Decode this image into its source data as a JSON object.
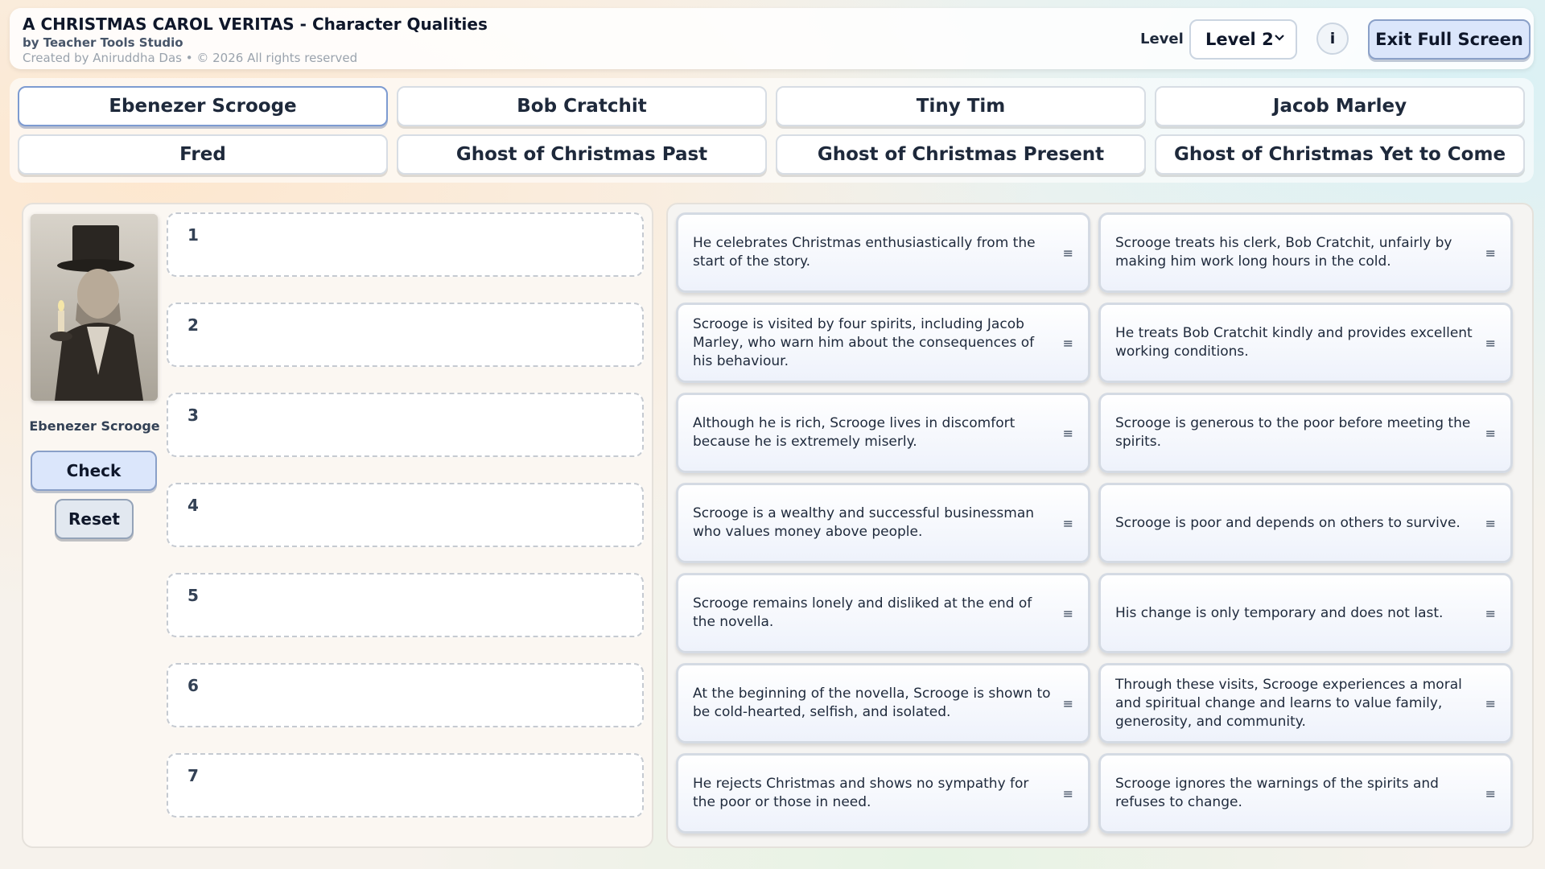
{
  "header": {
    "title": "A CHRISTMAS CAROL VERITAS - Character Qualities",
    "byline": "by Teacher Tools Studio",
    "credit": "Created by Aniruddha Das • © 2026 All rights reserved",
    "level_label": "Level",
    "level_value": "Level 2",
    "info_label": "i",
    "exit_label": "Exit Full Screen"
  },
  "tabs": [
    {
      "label": "Ebenezer Scrooge",
      "active": true
    },
    {
      "label": "Bob Cratchit"
    },
    {
      "label": "Tiny Tim"
    },
    {
      "label": "Jacob Marley"
    },
    {
      "label": "Fred"
    },
    {
      "label": "Ghost of Christmas Past"
    },
    {
      "label": "Ghost of Christmas Present"
    },
    {
      "label": "Ghost of Christmas Yet to Come"
    }
  ],
  "character": {
    "name": "Ebenezer Scrooge",
    "check_label": "Check",
    "reset_label": "Reset"
  },
  "slots": [
    "1",
    "2",
    "3",
    "4",
    "5",
    "6",
    "7"
  ],
  "cards": [
    "He celebrates Christmas enthusiastically from the start of the story.",
    "Scrooge treats his clerk, Bob Cratchit, unfairly by making him work long hours in the cold.",
    "Scrooge is visited by four spirits, including Jacob Marley, who warn him about the consequences of his behaviour.",
    "He treats Bob Cratchit kindly and provides excellent working conditions.",
    "Although he is rich, Scrooge lives in discomfort because he is extremely miserly.",
    "Scrooge is generous to the poor before meeting the spirits.",
    "Scrooge is a wealthy and successful businessman who values money above people.",
    "Scrooge is poor and depends on others to survive.",
    "Scrooge remains lonely and disliked at the end of the novella.",
    "His change is only temporary and does not last.",
    "At the beginning of the novella, Scrooge is shown to be cold-hearted, selfish, and isolated.",
    "Through these visits, Scrooge experiences a moral and spiritual change and learns to value family, generosity, and community.",
    "He rejects Christmas and shows no sympathy for the poor or those in need.",
    "Scrooge ignores the warnings of the spirits and refuses to change."
  ],
  "icons": {
    "drag_handle": "≡",
    "chevron": "⌄"
  },
  "colors": {
    "accent_button": "#dbe6fb",
    "active_tab_border": "#7d9bd1"
  }
}
